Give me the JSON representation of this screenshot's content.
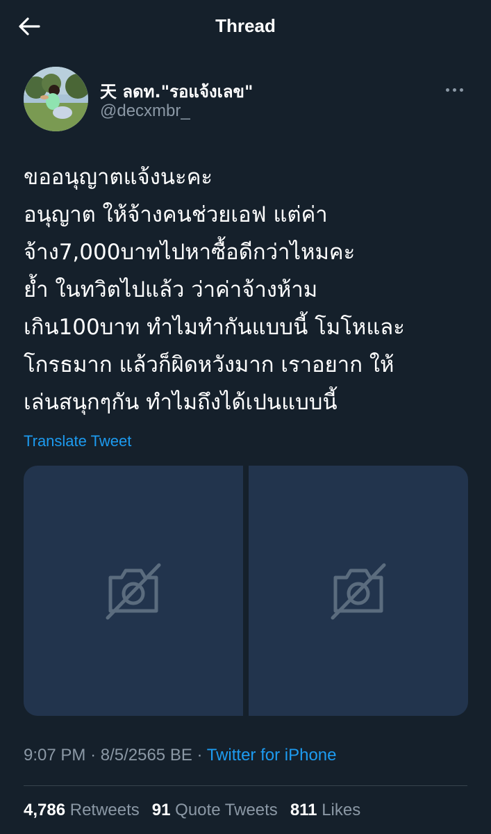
{
  "header": {
    "title": "Thread",
    "back_icon": "arrow-left-icon"
  },
  "author": {
    "display_name": "天 ลดท.\"รอแจ้งเลข\"",
    "handle": "@decxmbr_",
    "more_icon": "more-horizontal-icon"
  },
  "tweet": {
    "lines": [
      "ขออนุญาตแจ้งนะคะ",
      "อนุญาต ให้จ้างคนช่วยเอฟ แต่ค่า",
      "จ้าง7,000บาทไปหาซื้อดีกว่าไหมคะ",
      "ย้ำ ในทวิตไปแล้ว ว่าค่าจ้างห้าม",
      "เกิน100บาท ทำไมทำกันแบบนี้ โมโหและ",
      "โกรธมาก แล้วก็ผิดหวังมาก เราอยาก ให้",
      "เล่นสนุกๆกัน ทำไมถึงได้เปนแบบนี้"
    ],
    "translate_label": "Translate Tweet",
    "media": [
      {
        "icon": "image-unavailable-icon"
      },
      {
        "icon": "image-unavailable-icon"
      }
    ],
    "time": "9:07 PM",
    "date": "8/5/2565 BE",
    "separator": "·",
    "source": "Twitter for iPhone"
  },
  "stats": {
    "retweets_count": "4,786",
    "retweets_label": "Retweets",
    "quotes_count": "91",
    "quotes_label": "Quote Tweets",
    "likes_count": "811",
    "likes_label": "Likes"
  },
  "colors": {
    "background": "#15202b",
    "accent": "#1d9bf0",
    "secondary_text": "#8b98a5",
    "media_placeholder": "#22344d"
  }
}
